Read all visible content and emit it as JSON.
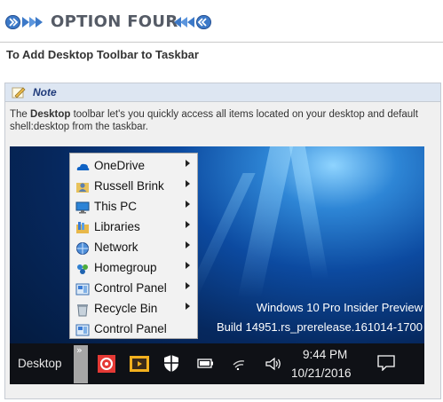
{
  "header": {
    "title": "OPTION FOUR"
  },
  "subtitle": "To Add Desktop Toolbar to Taskbar",
  "note": {
    "label": "Note",
    "text_before": "The ",
    "text_bold": "Desktop",
    "text_after": " toolbar let's you quickly access all items located on your desktop and default shell:desktop from the taskbar."
  },
  "screenshot": {
    "watermark_line1": "Windows 10 Pro Insider Preview",
    "watermark_line2": "Build 14951.rs_prerelease.161014-1700",
    "menu_items": [
      {
        "label": "OneDrive",
        "icon": "onedrive-icon"
      },
      {
        "label": "Russell Brink",
        "icon": "user-folder-icon"
      },
      {
        "label": "This PC",
        "icon": "this-pc-icon"
      },
      {
        "label": "Libraries",
        "icon": "libraries-icon"
      },
      {
        "label": "Network",
        "icon": "network-icon"
      },
      {
        "label": "Homegroup",
        "icon": "homegroup-icon"
      },
      {
        "label": "Control Panel",
        "icon": "control-panel-icon"
      },
      {
        "label": "Recycle Bin",
        "icon": "recycle-bin-icon"
      },
      {
        "label": "Control Panel",
        "icon": "control-panel-icon"
      }
    ],
    "taskbar": {
      "toolbar_label": "Desktop",
      "chevron": "»",
      "time": "9:44 PM",
      "date": "10/21/2016"
    }
  },
  "colors": {
    "accent": "#1f3a7a",
    "note_bar": "#dde6f2",
    "title": "#555b66"
  }
}
